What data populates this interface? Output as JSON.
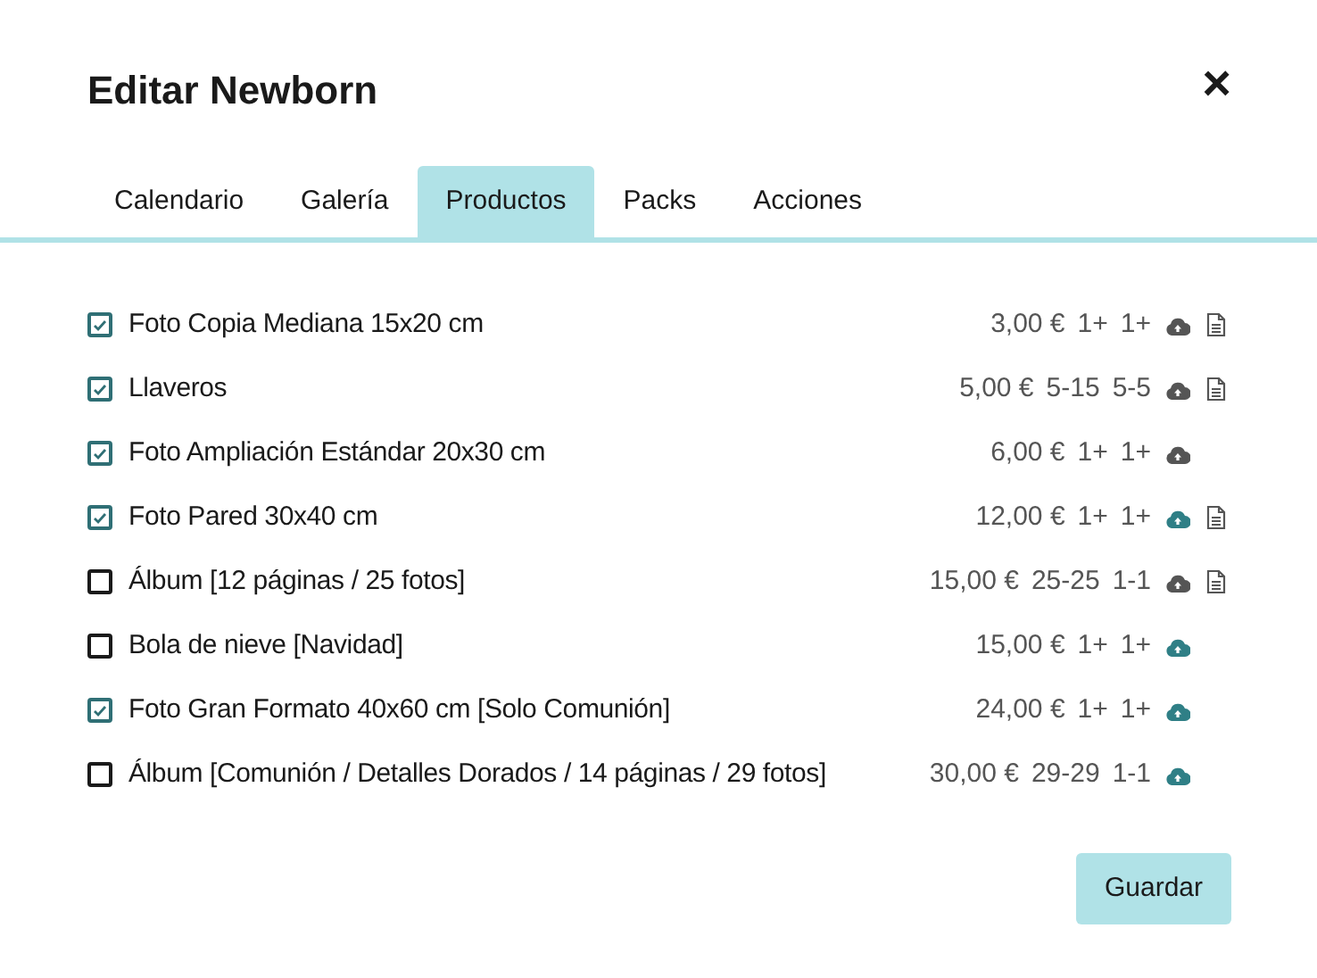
{
  "title": "Editar Newborn",
  "close": "×",
  "tabs": [
    {
      "label": "Calendario",
      "selected": false
    },
    {
      "label": "Galería",
      "selected": false
    },
    {
      "label": "Productos",
      "selected": true
    },
    {
      "label": "Packs",
      "selected": false
    },
    {
      "label": "Acciones",
      "selected": false
    }
  ],
  "products": [
    {
      "name": "Foto Copia Mediana 15x20 cm",
      "checked": true,
      "price": "3,00 €",
      "quantity_1": "1+",
      "quantity_2": "1+",
      "cloud_highlighted": false,
      "document": true
    },
    {
      "name": "Llaveros",
      "checked": true,
      "price": "5,00 €",
      "quantity_1": "5-15",
      "quantity_2": "5-5",
      "cloud_highlighted": false,
      "document": true
    },
    {
      "name": "Foto Ampliación Estándar 20x30 cm",
      "checked": true,
      "price": "6,00 €",
      "quantity_1": "1+",
      "quantity_2": "1+",
      "cloud_highlighted": false,
      "document": false
    },
    {
      "name": "Foto Pared 30x40 cm",
      "checked": true,
      "price": "12,00 €",
      "quantity_1": "1+",
      "quantity_2": "1+",
      "cloud_highlighted": true,
      "document": true
    },
    {
      "name": "Álbum [12 páginas / 25 fotos]",
      "checked": false,
      "price": "15,00 €",
      "quantity_1": "25-25",
      "quantity_2": "1-1",
      "cloud_highlighted": false,
      "document": true
    },
    {
      "name": "Bola de nieve [Navidad]",
      "checked": false,
      "price": "15,00 €",
      "quantity_1": "1+",
      "quantity_2": "1+",
      "cloud_highlighted": true,
      "document": false
    },
    {
      "name": "Foto Gran Formato 40x60 cm [Solo Comunión]",
      "checked": true,
      "price": "24,00 €",
      "quantity_1": "1+",
      "quantity_2": "1+",
      "cloud_highlighted": true,
      "document": false
    },
    {
      "name": "Álbum [Comunión / Detalles Dorados / 14 páginas / 29 fotos]",
      "checked": false,
      "price": "30,00 €",
      "quantity_1": "29-29",
      "quantity_2": "1-1",
      "cloud_highlighted": true,
      "document": false
    }
  ],
  "save_button": "Guardar"
}
